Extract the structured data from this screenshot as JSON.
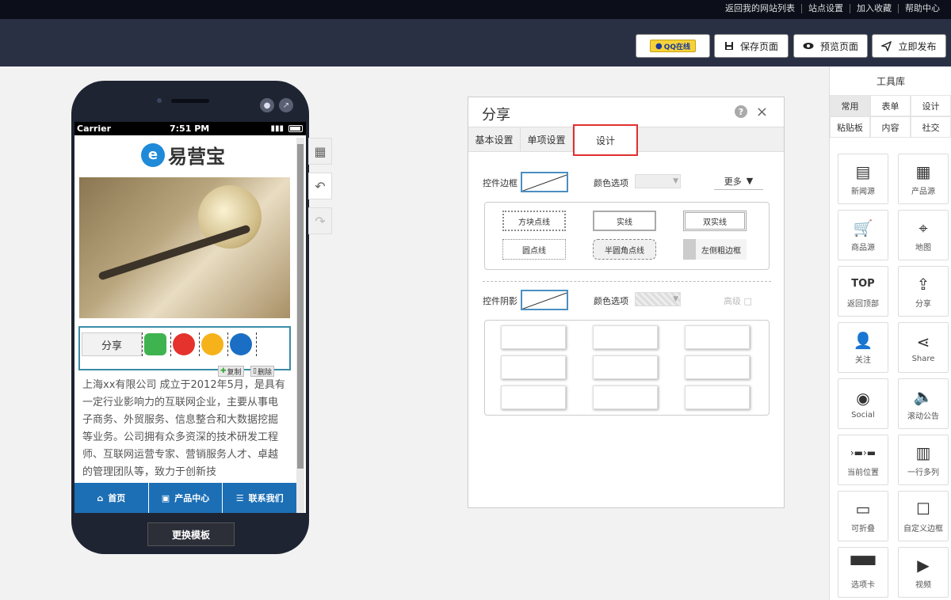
{
  "topbar": {
    "links": [
      "返回我的网站列表",
      "站点设置",
      "加入收藏",
      "帮助中心"
    ]
  },
  "header": {
    "qq_label": "QQ在线",
    "save_label": "保存页面",
    "preview_label": "预览页面",
    "publish_label": "立即发布"
  },
  "phone": {
    "carrier": "Carrier",
    "time": "7:51 PM",
    "logo_mark": "e",
    "logo_text": "易营宝",
    "share_label": "分享",
    "copy_label": "复制",
    "delete_label": "删除",
    "description": "上海xx有限公司 成立于2012年5月，是具有一定行业影响力的互联网企业，主要从事电子商务、外贸服务、信息整合和大数据挖掘等业务。公司拥有众多资深的技术研发工程师、互联网运营专家、营销服务人才、卓越的管理团队等，致力于创新技",
    "nav": [
      "首页",
      "产品中心",
      "联系我们"
    ],
    "change_template": "更换模板"
  },
  "panel": {
    "title": "分享",
    "help": "?",
    "close": "×",
    "tabs": [
      "基本设置",
      "单项设置",
      "设计"
    ],
    "border_label": "控件边框",
    "color_label": "颜色选项",
    "more_label": "更多",
    "border_options": [
      "方块点线",
      "实线",
      "双实线",
      "圆点线",
      "半圆角点线",
      "左侧粗边框"
    ],
    "shadow_label": "控件阴影",
    "shadow_color_label": "颜色选项",
    "advanced_label": "高级"
  },
  "toolbox": {
    "title": "工具库",
    "tabs": [
      "常用",
      "表单",
      "设计",
      "粘贴板",
      "内容",
      "社交"
    ],
    "items": [
      "新闻源",
      "产品源",
      "商品源",
      "地图",
      "返回顶部",
      "分享",
      "关注",
      "Share",
      "Social",
      "滚动公告",
      "当前位置",
      "一行多列",
      "可折叠",
      "自定义边框",
      "选项卡",
      "视频"
    ]
  },
  "colors": {
    "header_bg": "#2a3044",
    "accent_blue": "#1c6fb5",
    "active_tab_border": "#e03030"
  }
}
